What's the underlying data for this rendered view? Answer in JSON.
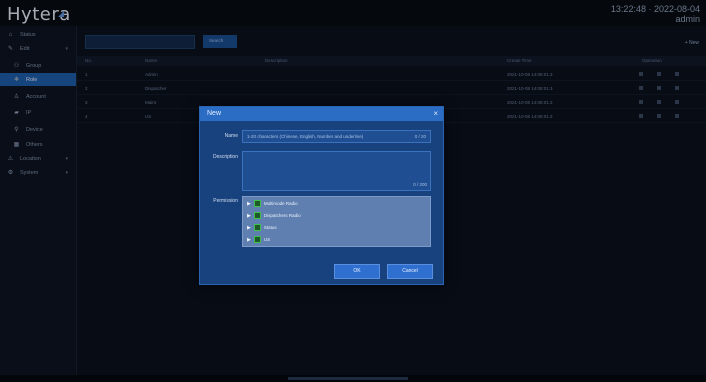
{
  "app": {
    "logo": "Hytera",
    "clock": "13:22:48 · 2022-08-04",
    "user": "admin"
  },
  "sidebar": {
    "items": [
      {
        "label": "Status",
        "icon": "home-icon"
      },
      {
        "label": "Edit",
        "icon": "edit-icon"
      },
      {
        "label": "Group",
        "icon": "group-icon"
      },
      {
        "label": "Role",
        "icon": "role-icon"
      },
      {
        "label": "Account",
        "icon": "account-icon"
      },
      {
        "label": "IP",
        "icon": "ip-icon"
      },
      {
        "label": "Device",
        "icon": "device-icon"
      },
      {
        "label": "Others",
        "icon": "others-icon"
      },
      {
        "label": "Location",
        "icon": "location-icon"
      },
      {
        "label": "System",
        "icon": "system-icon"
      }
    ]
  },
  "toolbar": {
    "search_label": "Search",
    "new_label": "+ New"
  },
  "table": {
    "headers": [
      "No.",
      "Name",
      "Description",
      "Create Time",
      "Operation"
    ],
    "rows": [
      {
        "no": "1",
        "name": "Admin",
        "desc": "",
        "time": "2021-10-08 14:08:01.3"
      },
      {
        "no": "2",
        "name": "Dispatcher",
        "desc": "",
        "time": "2021-10-08 14:08:01.3"
      },
      {
        "no": "3",
        "name": "Maint",
        "desc": "",
        "time": "2021-10-08 14:08:01.3"
      },
      {
        "no": "4",
        "name": "US",
        "desc": "",
        "time": "2021-10-08 14:08:01.3"
      }
    ]
  },
  "dialog": {
    "title": "New",
    "name_label": "Name",
    "name_value": "",
    "name_placeholder": "1-20 characters (Chinese, English, Number and underline)",
    "name_count": "0 / 20",
    "description_label": "Description",
    "description_count": "0 / 200",
    "permission_label": "Permission",
    "permissions": [
      "Multimode Radio",
      "Dispatchers Radio",
      "Status",
      "US"
    ],
    "ok_label": "OK",
    "cancel_label": "Cancel"
  },
  "colors": {
    "accent": "#2b6cc4",
    "active": "#1e5ca8",
    "check": "#3fc24d"
  }
}
